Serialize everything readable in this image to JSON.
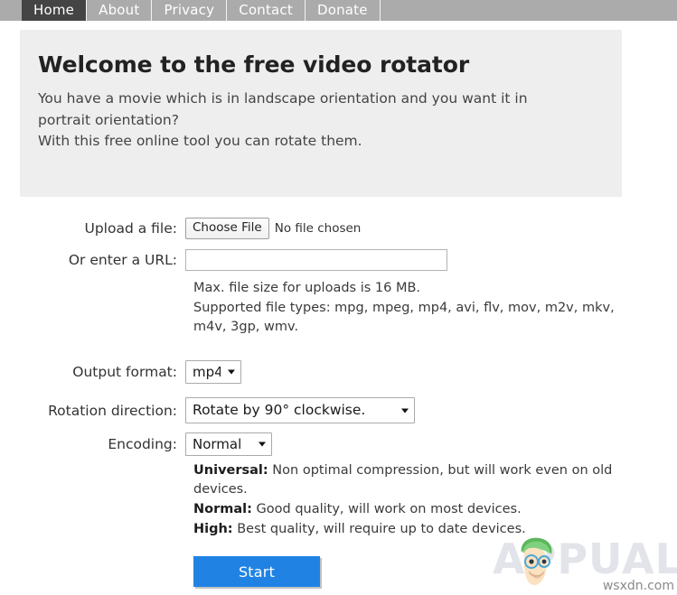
{
  "nav": {
    "items": [
      {
        "label": "Home",
        "active": true
      },
      {
        "label": "About",
        "active": false
      },
      {
        "label": "Privacy",
        "active": false
      },
      {
        "label": "Contact",
        "active": false
      },
      {
        "label": "Donate",
        "active": false
      }
    ]
  },
  "banner": {
    "title": "Welcome to the free video rotator",
    "line1": "You have a movie which is in landscape orientation and you want it in portrait orientation?",
    "line2": "With this free online tool you can rotate them."
  },
  "form": {
    "upload": {
      "label": "Upload a file:",
      "button_label": "Choose File",
      "status": "No file chosen"
    },
    "url": {
      "label": "Or enter a URL:",
      "value": "",
      "placeholder": ""
    },
    "hints": {
      "max_size": "Max. file size for uploads is 16 MB.",
      "supported": "Supported file types: mpg, mpeg, mp4, avi, flv, mov, m2v, mkv, m4v, 3gp, wmv."
    },
    "output_format": {
      "label": "Output format:",
      "selected": "mp4",
      "options": [
        "mp4"
      ]
    },
    "rotation": {
      "label": "Rotation direction:",
      "selected": "Rotate by 90° clockwise.",
      "options": [
        "Rotate by 90° clockwise."
      ]
    },
    "encoding": {
      "label": "Encoding:",
      "selected": "Normal",
      "options": [
        "Universal",
        "Normal",
        "High"
      ],
      "descriptions": [
        {
          "name": "Universal:",
          "text": " Non optimal compression, but will work even on old devices."
        },
        {
          "name": "Normal:",
          "text": " Good quality, will work on most devices."
        },
        {
          "name": "High:",
          "text": " Best quality, will require up to date devices."
        }
      ]
    },
    "submit_label": "Start"
  },
  "watermark": {
    "brand": "APPUALS",
    "domain": "wsxdn.com"
  },
  "colors": {
    "nav_bg": "#ababab",
    "nav_active_bg": "#444444",
    "banner_bg": "#eeeeee",
    "button_blue": "#2083e4",
    "watermark_gray": "#e2e4ea"
  }
}
